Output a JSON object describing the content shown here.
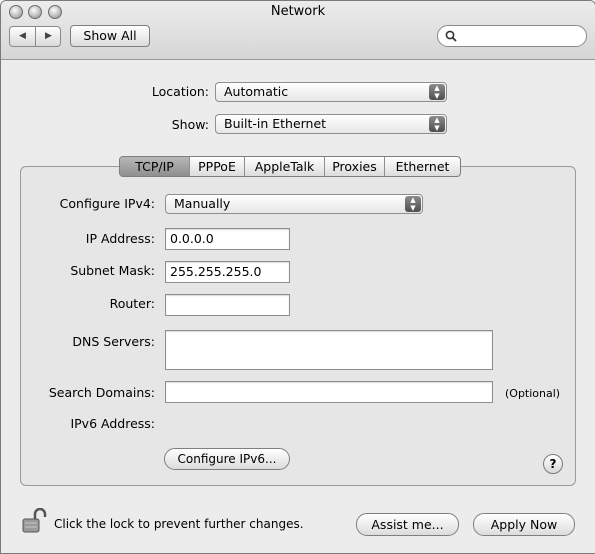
{
  "window": {
    "title": "Network"
  },
  "toolbar": {
    "show_all": "Show All",
    "search_value": ""
  },
  "location": {
    "label": "Location:",
    "value": "Automatic"
  },
  "show": {
    "label": "Show:",
    "value": "Built-in Ethernet"
  },
  "tabs": [
    "TCP/IP",
    "PPPoE",
    "AppleTalk",
    "Proxies",
    "Ethernet"
  ],
  "active_tab": "TCP/IP",
  "tcpip": {
    "configure_label": "Configure IPv4:",
    "configure_value": "Manually",
    "ip_label": "IP Address:",
    "ip_value": "0.0.0.0",
    "subnet_label": "Subnet Mask:",
    "subnet_value": "255.255.255.0",
    "router_label": "Router:",
    "router_value": "",
    "dns_label": "DNS Servers:",
    "dns_value": "",
    "search_label": "Search Domains:",
    "search_value": "",
    "optional_note": "(Optional)",
    "ipv6_label": "IPv6 Address:",
    "configure_ipv6_button": "Configure IPv6..."
  },
  "help_button": "?",
  "footer": {
    "lock_text": "Click the lock to prevent further changes.",
    "assist_button": "Assist me...",
    "apply_button": "Apply Now"
  },
  "icons": {
    "close": "traffic-light",
    "minimize": "traffic-light",
    "zoom": "traffic-light",
    "back": "back-arrow",
    "forward": "forward-arrow",
    "search": "magnifier",
    "lock": "unlocked-padlock"
  }
}
